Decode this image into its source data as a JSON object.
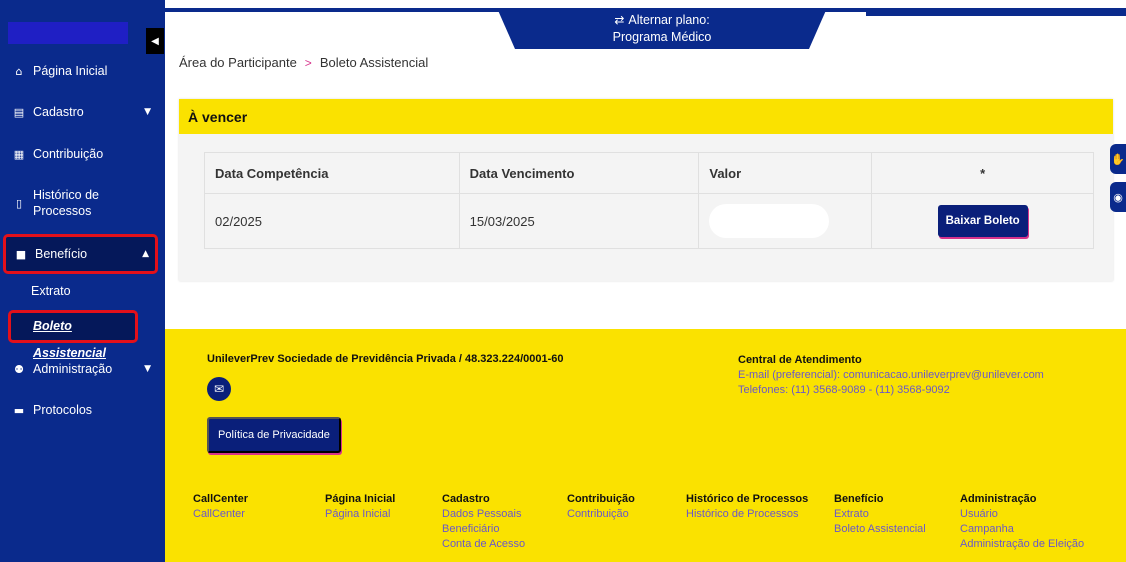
{
  "sidebar": {
    "collapse_icon": "caret-left-icon",
    "items": [
      {
        "label": "Página Inicial",
        "icon": "home-icon"
      },
      {
        "label": "Cadastro",
        "icon": "id-card-icon"
      },
      {
        "label": "Contribuição",
        "icon": "calculator-icon"
      },
      {
        "label": "Histórico de",
        "label2": "Processos",
        "icon": "file-icon"
      },
      {
        "label": "Benefício",
        "icon": "clipboard-icon"
      },
      {
        "label": "Administração",
        "icon": "users-icon"
      },
      {
        "label": "Protocolos",
        "icon": "inbox-icon"
      }
    ],
    "sub_items": [
      {
        "label": "Extrato"
      },
      {
        "label": "Boleto Assistencial"
      }
    ]
  },
  "header": {
    "plan_line1": "Alternar plano:",
    "plan_line2": "Programa Médico",
    "swap_icon": "swap-arrows-icon"
  },
  "breadcrumb": {
    "root": "Área do Participante",
    "separator": ">",
    "current": "Boleto Assistencial"
  },
  "card": {
    "title": "À vencer",
    "columns": [
      "Data Competência",
      "Data Vencimento",
      "Valor",
      "*"
    ],
    "rows": [
      {
        "competencia": "02/2025",
        "vencimento": "15/03/2025",
        "valor": "",
        "action": "Baixar Boleto"
      }
    ]
  },
  "footer": {
    "company": "UnileverPrev Sociedade de Previdência Privada / 48.323.224/0001-60",
    "privacy_button": "Política de Privacidade",
    "central_title": "Central de Atendimento",
    "central_email": "E-mail (preferencial): comunicacao.unileverprev@unilever.com",
    "central_phones": "Telefones: (11) 3568-9089 - (11) 3568-9092",
    "columns": [
      {
        "heading": "CallCenter",
        "links": [
          "CallCenter"
        ]
      },
      {
        "heading": "Página Inicial",
        "links": [
          "Página Inicial"
        ]
      },
      {
        "heading": "Cadastro",
        "links": [
          "Dados Pessoais",
          "Beneficiário",
          "Conta de Acesso"
        ]
      },
      {
        "heading": "Contribuição",
        "links": [
          "Contribuição"
        ]
      },
      {
        "heading": "Histórico de Processos",
        "links": [
          "Histórico de Processos"
        ]
      },
      {
        "heading": "Benefício",
        "links": [
          "Extrato",
          "Boleto Assistencial"
        ]
      },
      {
        "heading": "Administração",
        "links": [
          "Usuário",
          "Campanha",
          "Administração de Eleição"
        ]
      }
    ]
  },
  "colors": {
    "navy": "#0a2a8c",
    "yellow": "#fae200",
    "highlight": "#e3101a",
    "accent": "#d6338b"
  }
}
